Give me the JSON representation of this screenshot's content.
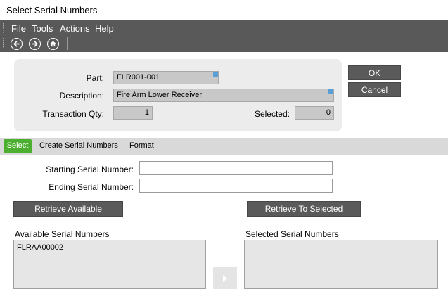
{
  "window": {
    "title": "Select Serial Numbers"
  },
  "menu": {
    "items": [
      "File",
      "Tools",
      "Actions",
      "Help"
    ]
  },
  "toolbar": {
    "icons": [
      "back-arrow-icon",
      "forward-arrow-icon",
      "home-icon"
    ]
  },
  "form": {
    "part_label": "Part:",
    "part_value": "FLR001-001",
    "description_label": "Description:",
    "description_value": "Fire Arm Lower Receiver",
    "transaction_qty_label": "Transaction Qty:",
    "transaction_qty_value": "1",
    "selected_label": "Selected:",
    "selected_value": "0"
  },
  "actions": {
    "ok_label": "OK",
    "cancel_label": "Cancel"
  },
  "tabs": [
    {
      "label": "Select",
      "active": true
    },
    {
      "label": "Create Serial Numbers",
      "active": false
    },
    {
      "label": "Format",
      "active": false
    }
  ],
  "select_tab": {
    "starting_serial_label": "Starting Serial Number:",
    "starting_serial_value": "",
    "ending_serial_label": "Ending Serial Number:",
    "ending_serial_value": "",
    "retrieve_available_label": "Retrieve Available",
    "retrieve_to_selected_label": "Retrieve To Selected",
    "available_header": "Available Serial Numbers",
    "available_items": [
      "FLRAA00002"
    ],
    "selected_header": "Selected Serial Numbers",
    "selected_items": []
  },
  "colors": {
    "toolbar_bg": "#595959",
    "active_tab": "#4caf2f",
    "field_corner": "#5aa0d8",
    "button_bg": "#5a5a5a"
  }
}
